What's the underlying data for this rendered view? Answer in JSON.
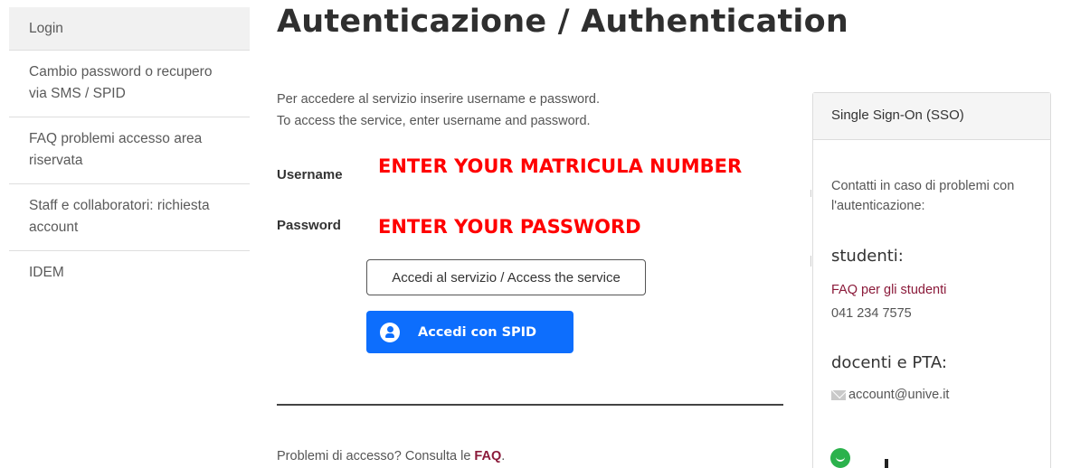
{
  "sidebar": {
    "items": [
      {
        "label": "Login"
      },
      {
        "label": "Cambio password o recupero via SMS / SPID"
      },
      {
        "label": "FAQ problemi accesso area riservata"
      },
      {
        "label": "Staff e collaboratori: richiesta account"
      },
      {
        "label": "IDEM"
      }
    ]
  },
  "main": {
    "title": "Autenticazione / Authentication",
    "intro_it": "Per accedere al servizio inserire username e password.",
    "intro_en": "To access the service, enter username and password.",
    "username_label": "Username",
    "password_label": "Password",
    "username_annotation": "ENTER YOUR MATRICULA NUMBER",
    "password_annotation": "ENTER YOUR PASSWORD",
    "access_button": "Accedi al servizio / Access the service",
    "spid_button": "Accedi con SPID",
    "problems_text": "Problemi di accesso? Consulta le ",
    "faq_link": "FAQ",
    "problems_end": "."
  },
  "panel": {
    "header": "Single Sign-On (SSO)",
    "contact_text": "Contatti in caso di problemi con l'autenticazione:",
    "students_heading": "studenti:",
    "students_faq_link": "FAQ per gli studenti",
    "students_phone": "041 234 7575",
    "staff_heading": "docenti e PTA:",
    "staff_email": "account@unive.it"
  },
  "icons": {
    "spid": "user-circle-icon",
    "mail": "envelope-icon",
    "chat": "smiley-chat-icon"
  },
  "colors": {
    "spid_blue": "#0d6efd",
    "annotation_red": "#ff0000",
    "link_maroon": "#8b1a3a"
  }
}
